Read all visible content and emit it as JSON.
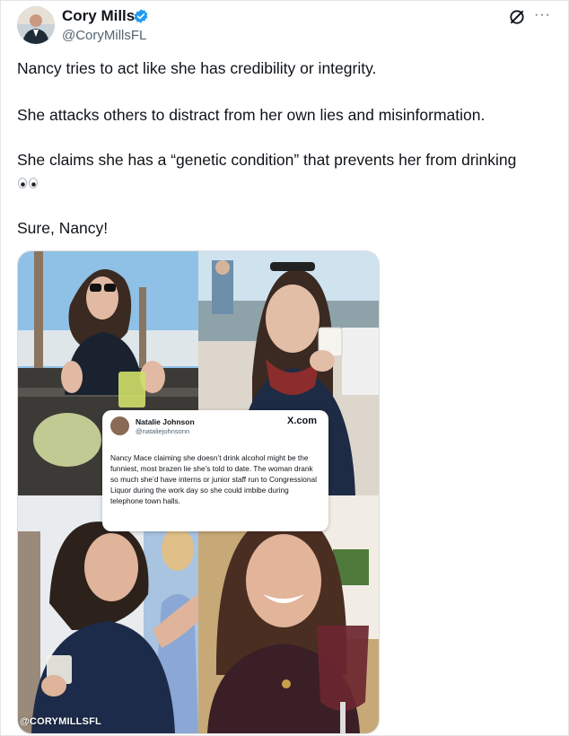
{
  "author": {
    "name": "Cory Mills",
    "handle": "@CoryMillsFL",
    "verified_icon": "verified-badge-icon",
    "verified_color": "#1d9bf0"
  },
  "header_actions": {
    "grok_icon": "grok-icon",
    "more_label": "···"
  },
  "post": {
    "line1": "Nancy tries to act like she has credibility or integrity.",
    "line2": "She attacks others to distract from her own lies and misinformation.",
    "line3": "She claims she has a “genetic condition” that prevents her from drinking",
    "line3_emoji": "eyes-emoji-icon",
    "line4": "Sure, Nancy!"
  },
  "media": {
    "watermark": "@CORYMILLSFL",
    "quoted_tweet": {
      "name": "Natalie Johnson",
      "handle": "@nataliejohnsonn",
      "brand": "X.com",
      "text": "Nancy Mace claiming she doesn’t drink alcohol might be the funniest, most brazen lie she’s told to date. The woman drank so much she’d have interns or junior staff run to Congressional Liquor during the work day so she could imbibe during telephone town halls."
    }
  }
}
